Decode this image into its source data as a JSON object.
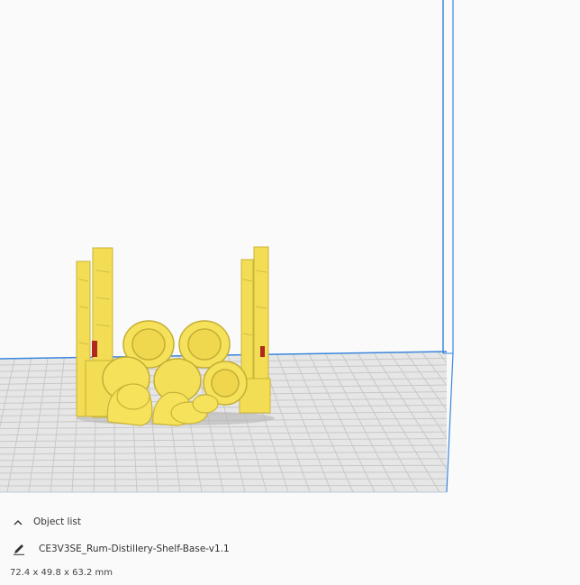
{
  "object_list": {
    "label": "Object list",
    "toggle_icon": "chevron-up-icon"
  },
  "object": {
    "name": "CE3V3SE_Rum-Distillery-Shelf-Base-v1.1",
    "edit_icon": "pencil-icon",
    "dimensions": "72.4 x 49.8 x 63.2 mm"
  },
  "colors": {
    "model": "#f7e35b",
    "model_shadow": "#c9b53a",
    "model_highlight_red": "#b0281e",
    "build_plate": "#e4e4e4",
    "grid_line": "#c6c6c6",
    "volume_edge": "#2f7bd6",
    "background": "#fafafa"
  }
}
